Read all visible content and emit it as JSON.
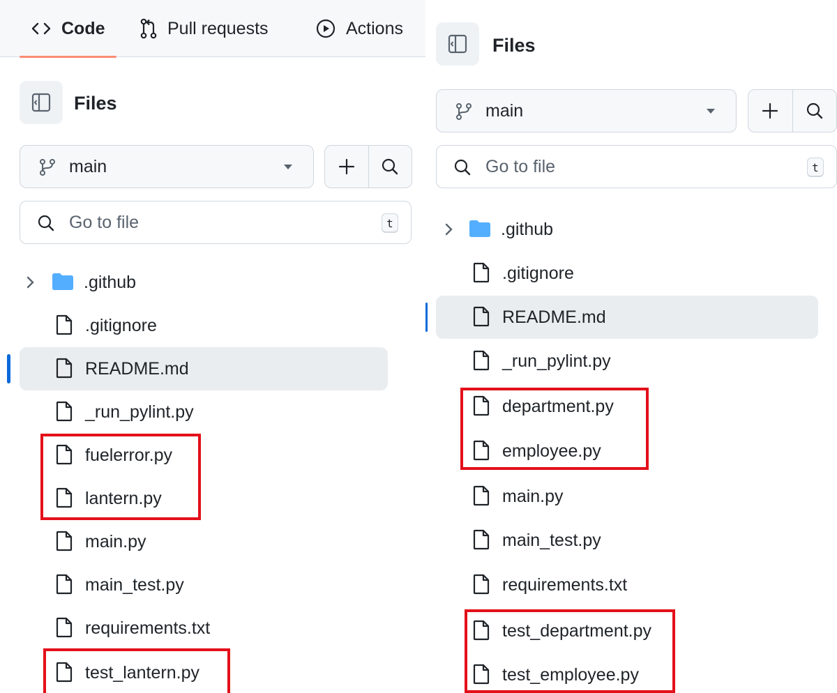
{
  "left": {
    "nav": {
      "tabs": [
        {
          "label": "Code",
          "icon": "code-icon",
          "active": true
        },
        {
          "label": "Pull requests",
          "icon": "git-pull-request-icon",
          "active": false
        },
        {
          "label": "Actions",
          "icon": "play-icon",
          "active": false
        }
      ]
    },
    "header": {
      "title": "Files"
    },
    "branch": {
      "name": "main"
    },
    "search": {
      "placeholder": "Go to file",
      "shortcut": "t"
    },
    "tree": [
      {
        "name": ".github",
        "type": "folder"
      },
      {
        "name": ".gitignore",
        "type": "file"
      },
      {
        "name": "README.md",
        "type": "file",
        "selected": true
      },
      {
        "name": "_run_pylint.py",
        "type": "file"
      },
      {
        "name": "fuelerror.py",
        "type": "file",
        "highlighted": true
      },
      {
        "name": "lantern.py",
        "type": "file",
        "highlighted": true
      },
      {
        "name": "main.py",
        "type": "file"
      },
      {
        "name": "main_test.py",
        "type": "file"
      },
      {
        "name": "requirements.txt",
        "type": "file"
      },
      {
        "name": "test_lantern.py",
        "type": "file",
        "highlighted": true
      }
    ]
  },
  "right": {
    "header": {
      "title": "Files"
    },
    "branch": {
      "name": "main"
    },
    "search": {
      "placeholder": "Go to file",
      "shortcut": "t"
    },
    "tree": [
      {
        "name": ".github",
        "type": "folder"
      },
      {
        "name": ".gitignore",
        "type": "file"
      },
      {
        "name": "README.md",
        "type": "file",
        "selected": true
      },
      {
        "name": "_run_pylint.py",
        "type": "file"
      },
      {
        "name": "department.py",
        "type": "file",
        "highlighted": true
      },
      {
        "name": "employee.py",
        "type": "file",
        "highlighted": true
      },
      {
        "name": "main.py",
        "type": "file"
      },
      {
        "name": "main_test.py",
        "type": "file"
      },
      {
        "name": "requirements.txt",
        "type": "file"
      },
      {
        "name": "test_department.py",
        "type": "file",
        "highlighted": true
      },
      {
        "name": "test_employee.py",
        "type": "file",
        "highlighted": true
      }
    ]
  },
  "colors": {
    "highlight_box": "#e3101a",
    "selected_indicator": "#0969da",
    "folder": "#54aeff",
    "active_tab_underline": "#fd8c73"
  }
}
